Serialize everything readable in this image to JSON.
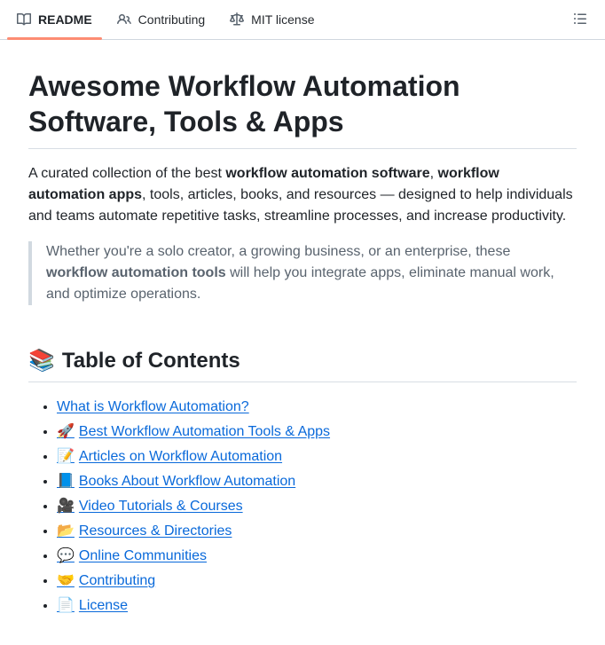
{
  "header": {
    "tabs": [
      {
        "label": "README",
        "icon": "book-icon",
        "active": true
      },
      {
        "label": "Contributing",
        "icon": "people-icon",
        "active": false
      },
      {
        "label": "MIT license",
        "icon": "law-icon",
        "active": false
      }
    ]
  },
  "article": {
    "title": "Awesome Workflow Automation Software, Tools & Apps",
    "intro_rich": [
      {
        "t": "A curated collection of the best ",
        "b": false
      },
      {
        "t": "workflow automation software",
        "b": true
      },
      {
        "t": ", ",
        "b": false
      },
      {
        "t": "workflow automation apps",
        "b": true
      },
      {
        "t": ", tools, articles, books, and resources — designed to help individuals and teams automate repetitive tasks, streamline processes, and increase productivity.",
        "b": false
      }
    ],
    "quote_rich": [
      {
        "t": "Whether you're a solo creator, a growing business, or an enterprise, these ",
        "b": false
      },
      {
        "t": "workflow automation tools",
        "b": true
      },
      {
        "t": " will help you integrate apps, eliminate manual work, and optimize operations.",
        "b": false
      }
    ],
    "toc": {
      "heading_emoji": "📚",
      "heading_text": "Table of Contents",
      "items": [
        {
          "emoji": "",
          "label": "What is Workflow Automation?"
        },
        {
          "emoji": "🚀",
          "label": "Best Workflow Automation Tools & Apps"
        },
        {
          "emoji": "📝",
          "label": "Articles on Workflow Automation"
        },
        {
          "emoji": "📘",
          "label": "Books About Workflow Automation"
        },
        {
          "emoji": "🎥",
          "label": "Video Tutorials & Courses"
        },
        {
          "emoji": "📂",
          "label": "Resources & Directories"
        },
        {
          "emoji": "💬",
          "label": "Online Communities"
        },
        {
          "emoji": "🤝",
          "label": "Contributing"
        },
        {
          "emoji": "📄",
          "label": "License"
        }
      ]
    }
  },
  "colors": {
    "accent_tab_underline": "#fd8c73",
    "link": "#0969da",
    "text": "#1f2328",
    "muted_text": "#59636e",
    "border": "#d0d7de"
  }
}
